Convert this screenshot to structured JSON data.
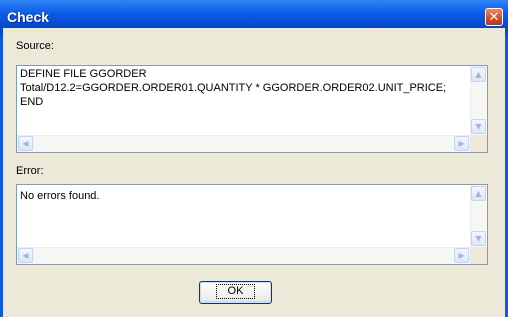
{
  "window": {
    "title": "Check",
    "title_marks": "' '",
    "close_glyph": "✕",
    "colors": {
      "titlebar": "#0a5ae6",
      "client": "#ece9d8",
      "close": "#cf4a2a"
    }
  },
  "source": {
    "label": "Source:",
    "text": "DEFINE FILE GGORDER\nTotal/D12.2=GGORDER.ORDER01.QUANTITY * GGORDER.ORDER02.UNIT_PRICE;\nEND"
  },
  "error": {
    "label": "Error:",
    "text": "No errors found."
  },
  "scroll_glyphs": {
    "up": "▲",
    "down": "▼",
    "left": "◀",
    "right": "▶"
  },
  "ok_button": {
    "label": "OK"
  }
}
